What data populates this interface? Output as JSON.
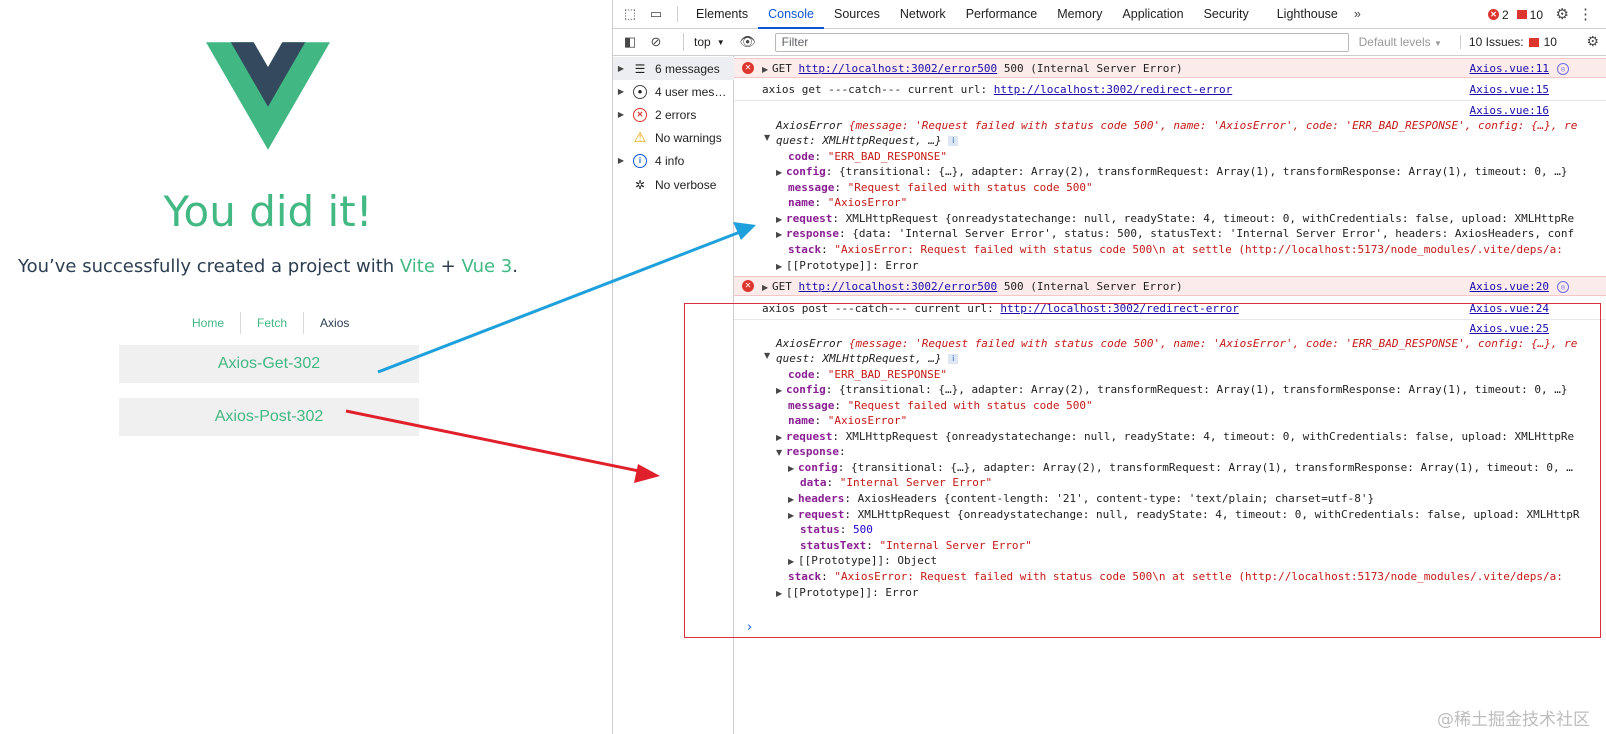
{
  "app": {
    "headline": "You did it!",
    "subline_before": "You’ve successfully created a project with ",
    "subline_vite": "Vite",
    "subline_plus": " + ",
    "subline_vue": "Vue 3",
    "subline_after": ".",
    "nav": [
      "Home",
      "Fetch",
      "Axios"
    ],
    "buttons": [
      "Axios-Get-302",
      "Axios-Post-302"
    ],
    "colors": {
      "vue_green": "#42b883",
      "vue_dark": "#35495e"
    }
  },
  "devtools": {
    "tabs": [
      "Elements",
      "Console",
      "Sources",
      "Network",
      "Performance",
      "Memory",
      "Application",
      "Security",
      "Lighthouse"
    ],
    "active_tab": "Console",
    "error_count": "2",
    "issue_count": "10",
    "context": "top",
    "filter_placeholder": "Filter",
    "levels": "Default levels",
    "issues_label": "10 Issues:",
    "issues_count": "10",
    "sidebar": [
      {
        "label": "6 messages",
        "icon": "list-icon"
      },
      {
        "label": "4 user mes…",
        "icon": "user-icon"
      },
      {
        "label": "2 errors",
        "icon": "error-icon"
      },
      {
        "label": "No warnings",
        "icon": "warning-icon"
      },
      {
        "label": "4 info",
        "icon": "info-icon"
      },
      {
        "label": "No verbose",
        "icon": "bug-icon"
      }
    ],
    "console": {
      "err1_method": "GET",
      "err1_url": "http://localhost:3002/error500",
      "err1_status": "500 (Internal Server Error)",
      "err1_src": "Axios.vue:11",
      "log1_text": "axios get ---catch--- current url: ",
      "log1_url": "http://localhost:3002/redirect-error",
      "log1_src": "Axios.vue:15",
      "obj1_src": "Axios.vue:16",
      "err2_method": "GET",
      "err2_url": "http://localhost:3002/error500",
      "err2_status": "500 (Internal Server Error)",
      "err2_src": "Axios.vue:20",
      "log2_text": "axios post ---catch--- current url: ",
      "log2_url": "http://localhost:3002/redirect-error",
      "log2_src": "Axios.vue:24",
      "obj2_src": "Axios.vue:25",
      "obj_head_a": "AxiosError ",
      "obj_head_b": "{message: 'Request failed with status code 500', name: 'AxiosError', code: 'ERR_BAD_RESPONSE', config: {…}, re",
      "obj_head_c": "quest: XMLHttpRequest, …}",
      "code_val": "\"ERR_BAD_RESPONSE\"",
      "config_val": "{transitional: {…}, adapter: Array(2), transformRequest: Array(1), transformResponse: Array(1), timeout: 0, …}",
      "message_val": "\"Request failed with status code 500\"",
      "name_val": "\"AxiosError\"",
      "request_val": "XMLHttpRequest {onreadystatechange: null, readyState: 4, timeout: 0, withCredentials: false, upload: XMLHttpRe",
      "response_val": "{data: 'Internal Server Error', status: 500, statusText: 'Internal Server Error', headers: AxiosHeaders, conf",
      "stack_val": "\"AxiosError: Request failed with status code 500\\n    at settle (http://localhost:5173/node_modules/.vite/deps/a:",
      "proto_val": "[[Prototype]]: Error",
      "resp_config_val": "{transitional: {…}, adapter: Array(2), transformRequest: Array(1), transformResponse: Array(1), timeout: 0, …",
      "resp_data_val": "\"Internal Server Error\"",
      "resp_headers_val": "AxiosHeaders {content-length: '21', content-type: 'text/plain; charset=utf-8'}",
      "resp_request_val": "XMLHttpRequest {onreadystatechange: null, readyState: 4, timeout: 0, withCredentials: false, upload: XMLHttpR",
      "resp_status_val": "500",
      "resp_statustext_val": "\"Internal Server Error\"",
      "resp_proto_val": "[[Prototype]]: Object"
    }
  },
  "watermark": "@稀土掘金技术社区",
  "annotation_colors": {
    "blue_arrow": "#1ea0dc",
    "red_arrow": "#e0202b",
    "red_box": "#d9303d"
  }
}
